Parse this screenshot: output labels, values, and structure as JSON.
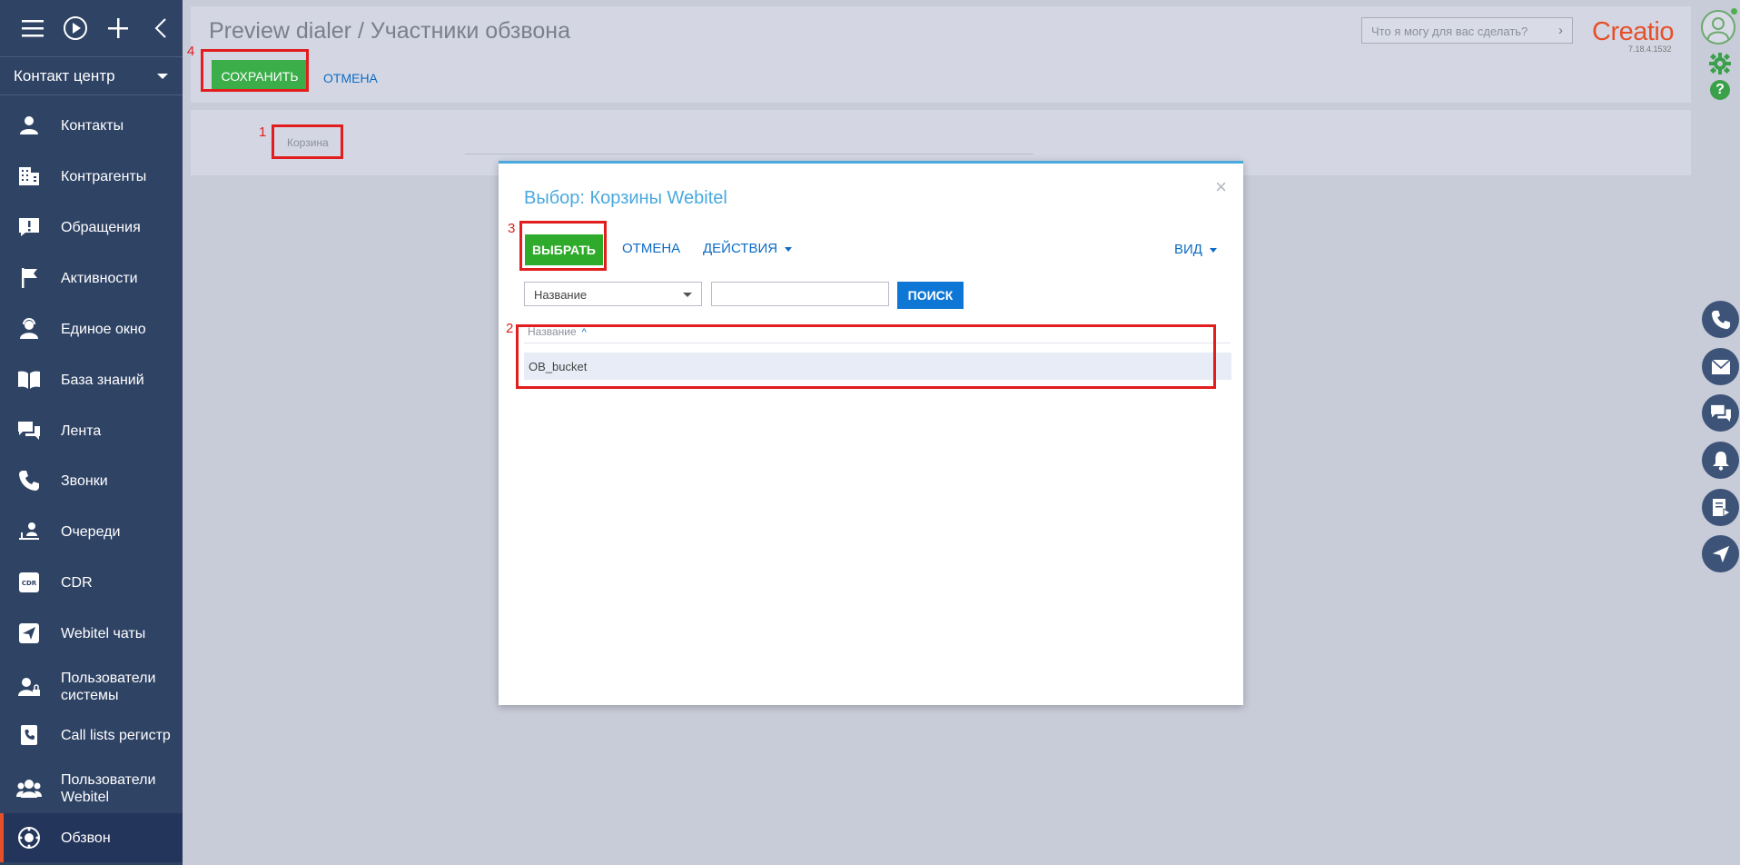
{
  "sidebar": {
    "workspace": "Контакт центр",
    "items": [
      {
        "label": "Контакты",
        "icon": "person-icon"
      },
      {
        "label": "Контрагенты",
        "icon": "building-icon"
      },
      {
        "label": "Обращения",
        "icon": "exclamation-icon"
      },
      {
        "label": "Активности",
        "icon": "flag-icon"
      },
      {
        "label": "Единое окно",
        "icon": "person-headset-icon"
      },
      {
        "label": "База знаний",
        "icon": "book-icon"
      },
      {
        "label": "Лента",
        "icon": "chat-icon"
      },
      {
        "label": "Звонки",
        "icon": "phone-icon"
      },
      {
        "label": "Очереди",
        "icon": "queue-icon"
      },
      {
        "label": "CDR",
        "icon": "cdr-icon"
      },
      {
        "label": "Webitel чаты",
        "icon": "send-icon"
      },
      {
        "label": "Пользователи системы",
        "icon": "user-lock-icon"
      },
      {
        "label": "Call lists регистр",
        "icon": "phone-book-icon"
      },
      {
        "label": "Пользователи Webitel",
        "icon": "users-icon"
      },
      {
        "label": "Обзвон",
        "icon": "dialer-icon"
      }
    ]
  },
  "header": {
    "title": "Preview dialer / Участники обзвона",
    "save_label": "СОХРАНИТЬ",
    "cancel_label": "ОТМЕНА",
    "search_placeholder": "Что я могу для вас сделать?",
    "logo": "Creatio",
    "version": "7.18.4.1532"
  },
  "field": {
    "label": "Корзина"
  },
  "modal": {
    "title": "Выбор: Корзины Webitel",
    "select_label": "ВЫБРАТЬ",
    "cancel_label": "ОТМЕНА",
    "actions_label": "ДЕЙСТВИЯ",
    "view_label": "ВИД",
    "filter_column": "Название",
    "search_label": "ПОИСК",
    "column_header": "Название",
    "rows": [
      "OB_bucket"
    ]
  },
  "annotations": [
    "1",
    "2",
    "3",
    "4"
  ],
  "colors": {
    "sidebar_bg": "#2f4365",
    "accent_green": "#3bae4a",
    "link_blue": "#0e6cc4",
    "modal_title": "#4aa9dd",
    "annotation_red": "#e11d1d",
    "brand_orange": "#e5502a"
  }
}
